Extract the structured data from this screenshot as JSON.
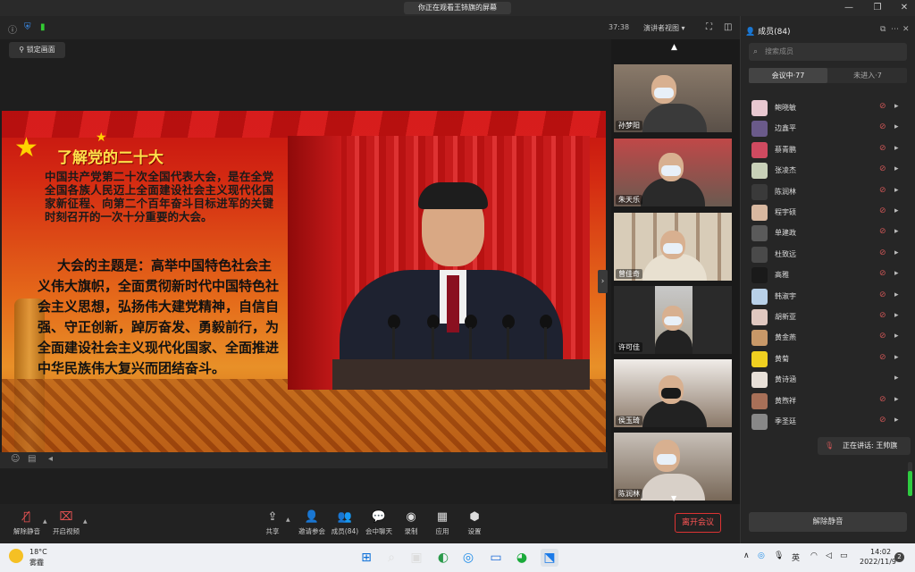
{
  "window": {
    "title": "你正在观看王铈旗的屏幕",
    "controls": [
      "—",
      "❐",
      "✕"
    ]
  },
  "meeting": {
    "timer": "37:38",
    "view_mode": "演讲者视图 ▾",
    "lock_screen": "锁定画面"
  },
  "slide": {
    "title": "了解党的二十大",
    "paragraph1": "中国共产党第二十次全国代表大会，是在全党全国各族人民迈上全面建设社会主义现代化国家新征程、向第二个百年奋斗目标进军的关键时刻召开的一次十分重要的大会。",
    "paragraph2": "大会的主题是：高举中国特色社会主义伟大旗帜，全面贯彻新时代中国特色社会主义思想，弘扬伟大建党精神，自信自强、守正创新，踔厉奋发、勇毅前行，为全面建设社会主义现代化国家、全面推进中华民族伟大复兴而团结奋斗。"
  },
  "video_tiles": [
    {
      "name": "孙梦阳"
    },
    {
      "name": "朱天乐"
    },
    {
      "name": "曾佳奇"
    },
    {
      "name": "许可佳"
    },
    {
      "name": "侯玉琦"
    },
    {
      "name": "陈润林"
    }
  ],
  "toolbar": {
    "mute": "解除静音",
    "video": "开启视频",
    "share": "共享",
    "invite": "邀请参会",
    "members": "成员(84)",
    "chat": "会中聊天",
    "record": "录制",
    "apps": "应用",
    "settings": "设置",
    "leave": "离开会议"
  },
  "panel": {
    "title": "成员(84)",
    "search_placeholder": "搜索成员",
    "tab_in_meeting": "会议中·77",
    "tab_not_joined": "未进入·7",
    "unmute_all": "解除静音",
    "speaking": "正在讲话: 王帅旗",
    "mic_level": 0.75,
    "members": [
      {
        "name": "鲍晓敏",
        "color": "#e8c8d0"
      },
      {
        "name": "边鑫平",
        "color": "#6a5a8a"
      },
      {
        "name": "蔡青鹏",
        "color": "#d04a60"
      },
      {
        "name": "张凌杰",
        "color": "#c8d0b8"
      },
      {
        "name": "陈润林",
        "color": "#3a3a3a"
      },
      {
        "name": "程宇硕",
        "color": "#d8b8a0"
      },
      {
        "name": "单建政",
        "color": "#5a5a5a"
      },
      {
        "name": "杜致远",
        "color": "#4a4a4a"
      },
      {
        "name": "高雅",
        "color": "#1a1a1a"
      },
      {
        "name": "韩淑宇",
        "color": "#b8d0e8"
      },
      {
        "name": "胡新亚",
        "color": "#e0c8c0"
      },
      {
        "name": "黄金燕",
        "color": "#c89868"
      },
      {
        "name": "黄菊",
        "color": "#f0d020"
      },
      {
        "name": "黄诗涵",
        "color": "#e8e0d8"
      },
      {
        "name": "黄煦祥",
        "color": "#a87058"
      },
      {
        "name": "季圣廷",
        "color": "#888888"
      }
    ]
  },
  "taskbar": {
    "weather_temp": "18°C",
    "weather_desc": "雾霾",
    "lang": "英",
    "time": "14:02",
    "date": "2022/11/9",
    "notifications": "2"
  }
}
